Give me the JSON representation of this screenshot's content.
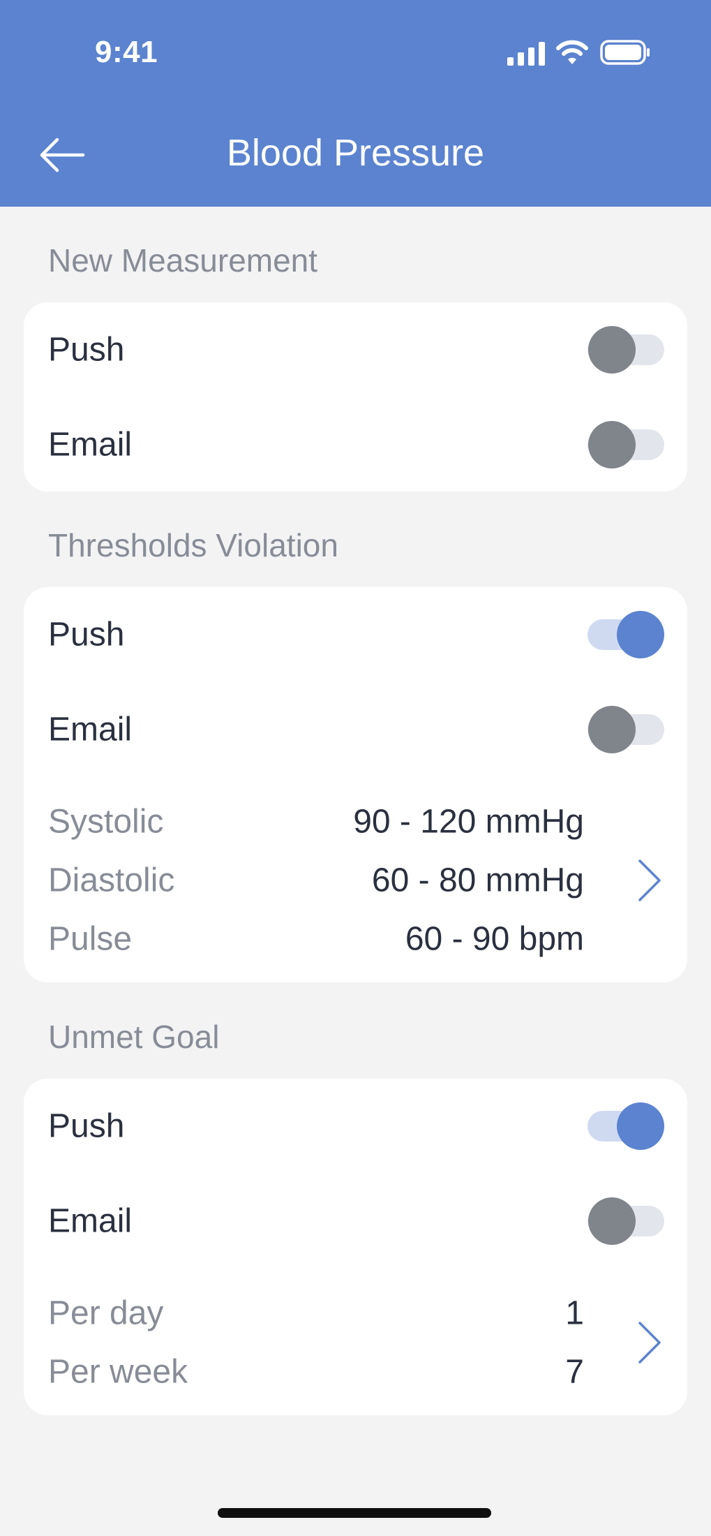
{
  "status_bar": {
    "time": "9:41"
  },
  "header": {
    "title": "Blood Pressure"
  },
  "sections": [
    {
      "title": "New Measurement",
      "rows": [
        {
          "label": "Push",
          "enabled": false
        },
        {
          "label": "Email",
          "enabled": false
        }
      ]
    },
    {
      "title": "Thresholds Violation",
      "rows": [
        {
          "label": "Push",
          "enabled": true
        },
        {
          "label": "Email",
          "enabled": false
        }
      ],
      "details": [
        {
          "label": "Systolic",
          "value": "90 - 120 mmHg"
        },
        {
          "label": "Diastolic",
          "value": "60 - 80 mmHg"
        },
        {
          "label": "Pulse",
          "value": "60 - 90 bpm"
        }
      ]
    },
    {
      "title": "Unmet Goal",
      "rows": [
        {
          "label": "Push",
          "enabled": true
        },
        {
          "label": "Email",
          "enabled": false
        }
      ],
      "details": [
        {
          "label": "Per day",
          "value": "1"
        },
        {
          "label": "Per week",
          "value": "7"
        }
      ]
    }
  ],
  "icons": {
    "back": "arrow-left-icon",
    "chevron": "chevron-right-icon",
    "signal": "cellular-signal-icon",
    "wifi": "wifi-icon",
    "battery": "battery-icon"
  },
  "colors": {
    "accent": "#5b83cf",
    "background": "#f3f3f4",
    "card": "#ffffff",
    "toggle_off_knob": "#80848b",
    "toggle_off_track": "#e2e5ec",
    "toggle_on_track": "#cfdaf1"
  }
}
